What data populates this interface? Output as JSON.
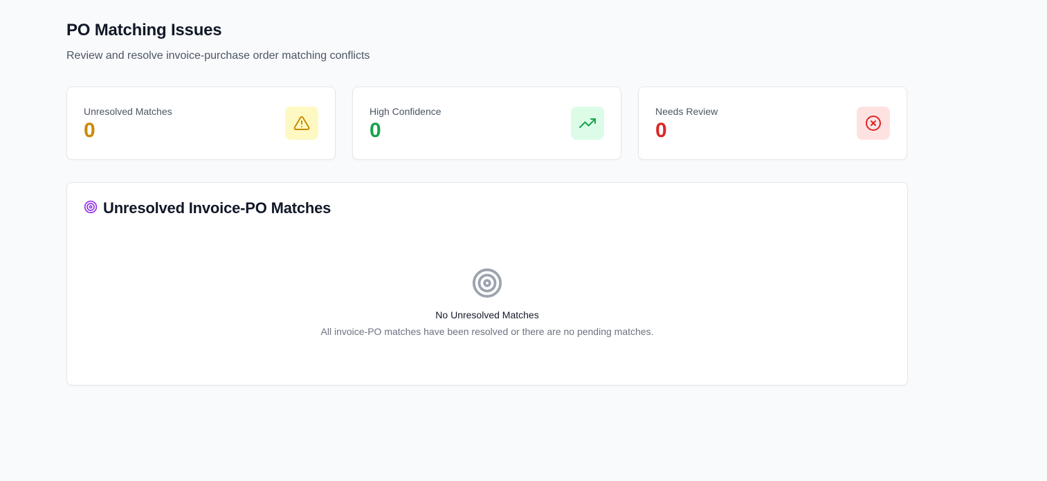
{
  "header": {
    "title": "PO Matching Issues",
    "subtitle": "Review and resolve invoice-purchase order matching conflicts"
  },
  "stats": [
    {
      "label": "Unresolved Matches",
      "value": "0",
      "value_color": "#ca8a04",
      "icon": "alert-triangle-icon",
      "icon_bg": "#fef9c3",
      "icon_color": "#ca8a04"
    },
    {
      "label": "High Confidence",
      "value": "0",
      "value_color": "#16a34a",
      "icon": "trending-up-icon",
      "icon_bg": "#dcfce7",
      "icon_color": "#16a34a"
    },
    {
      "label": "Needs Review",
      "value": "0",
      "value_color": "#dc2626",
      "icon": "x-circle-icon",
      "icon_bg": "#fee2e2",
      "icon_color": "#dc2626"
    }
  ],
  "panel": {
    "title": "Unresolved Invoice-PO Matches",
    "title_icon": "target-icon",
    "title_icon_color": "#9333ea",
    "empty": {
      "icon": "target-icon",
      "icon_color": "#9ca3af",
      "title": "No Unresolved Matches",
      "description": "All invoice-PO matches have been resolved or there are no pending matches."
    }
  }
}
